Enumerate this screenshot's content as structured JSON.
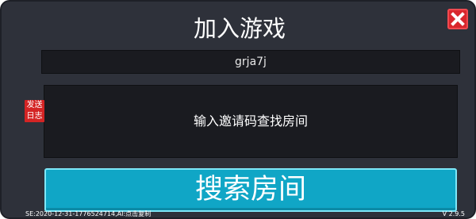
{
  "dialog": {
    "title": "加入游戏",
    "close_icon": "close-x-icon",
    "room_code_value": "grja7j",
    "search_prompt": "输入邀请码查找房间",
    "send_log_line1": "发送",
    "send_log_line2": "日志",
    "search_button_label": "搜索房间"
  },
  "footer": {
    "session_info": "SE:2020-12-31-1776524714,AI:点击复制",
    "version": "V 2.9.5"
  },
  "colors": {
    "panel_bg": "#2e313a",
    "field_bg": "#1a1b20",
    "close_red": "#d9262c",
    "log_red": "#d42424",
    "search_cyan": "#10a6c6"
  }
}
